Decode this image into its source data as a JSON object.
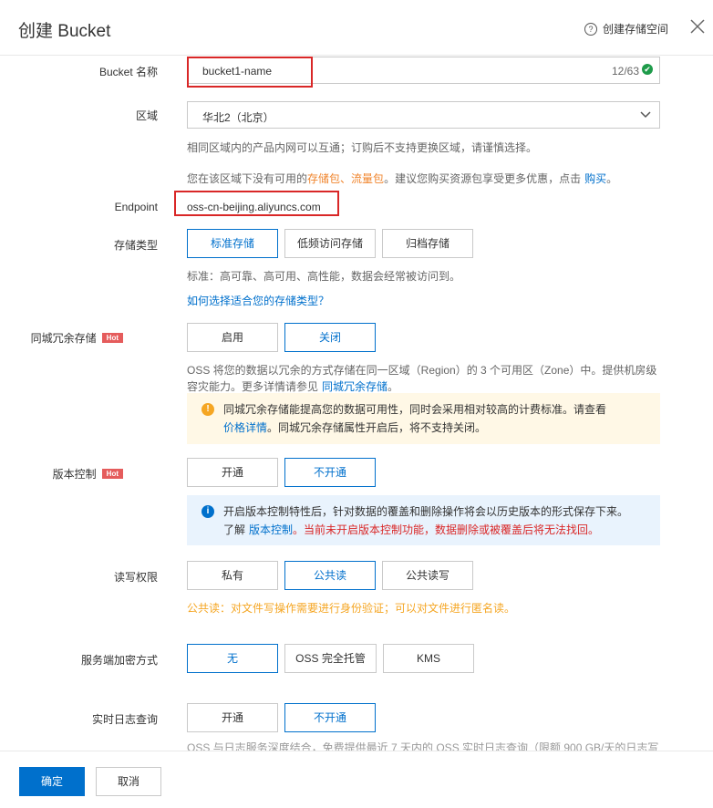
{
  "dialog": {
    "title": "创建 Bucket",
    "help_link": "创建存储空间",
    "help_icon": "?",
    "close_icon": "close-icon"
  },
  "bucket_name": {
    "label": "Bucket 名称",
    "value": "bucket1-name",
    "counter": "12/63",
    "check_icon": "✔"
  },
  "region": {
    "label": "区域",
    "value": "华北2（北京）",
    "hint": "相同区域内的产品内网可以互通；订购后不支持更换区域，请谨慎选择。",
    "promo_prefix": "您在该区域下没有可用的",
    "promo_pkg1": "存储包",
    "promo_sep": "、",
    "promo_pkg2": "流量包",
    "promo_mid": "。建议您购买资源包享受更多优惠，点击",
    "promo_link": "购买",
    "promo_end": "。"
  },
  "endpoint": {
    "label": "Endpoint",
    "value": "oss-cn-beijing.aliyuncs.com"
  },
  "storage_class": {
    "label": "存储类型",
    "options": [
      "标准存储",
      "低频访问存储",
      "归档存储"
    ],
    "selected": "标准存储",
    "desc": "标准：高可靠、高可用、高性能，数据会经常被访问到。",
    "link": "如何选择适合您的存储类型？"
  },
  "zrs": {
    "label": "同城冗余存储",
    "badge": "Hot",
    "options": [
      "启用",
      "关闭"
    ],
    "selected": "关闭",
    "desc_line1": "OSS 将您的数据以冗余的方式存储在同一区域（Region）的 3 个可用区（Zone）中。提供机房级",
    "desc_line2_prefix": "容灾能力。更多详情请参见",
    "desc_link": "同城冗余存储",
    "desc_line2_end": "。",
    "warn_icon": "!",
    "warn_line1": "同城冗余存储能提高您的数据可用性，同时会采用相对较高的计费标准。请查看",
    "warn_link": "价格详情",
    "warn_line2": "。同城冗余存储属性开启后，将不支持关闭。"
  },
  "versioning": {
    "label": "版本控制",
    "badge": "Hot",
    "options": [
      "开通",
      "不开通"
    ],
    "selected": "不开通",
    "info_icon": "i",
    "info_line1": "开启版本控制特性后，针对数据的覆盖和删除操作将会以历史版本的形式保存下来。",
    "info_prefix": "了解",
    "info_link": "版本控制",
    "info_sep": "。",
    "info_warn": "当前未开启版本控制功能，数据删除或被覆盖后将无法找回。"
  },
  "acl": {
    "label": "读写权限",
    "options": [
      "私有",
      "公共读",
      "公共读写"
    ],
    "selected": "公共读",
    "warn": "公共读：对文件写操作需要进行身份验证；可以对文件进行匿名读。"
  },
  "encryption": {
    "label": "服务端加密方式",
    "options": [
      "无",
      "OSS 完全托管",
      "KMS"
    ],
    "selected": "无"
  },
  "realtime_log": {
    "label": "实时日志查询",
    "options": [
      "开通",
      "不开通"
    ],
    "selected": "不开通",
    "desc_partial": "OSS 与日志服务深度结合，免费提供最近 7 天内的 OSS 实时日志查询（限额 900 GB/天的日志写"
  },
  "footer": {
    "ok": "确定",
    "cancel": "取消"
  },
  "colors": {
    "primary": "#0070cc",
    "highlight_box": "#d92727",
    "hot_badge": "#e55c5c",
    "warn_bg": "#fff8e6",
    "info_bg": "#e9f3fd"
  }
}
